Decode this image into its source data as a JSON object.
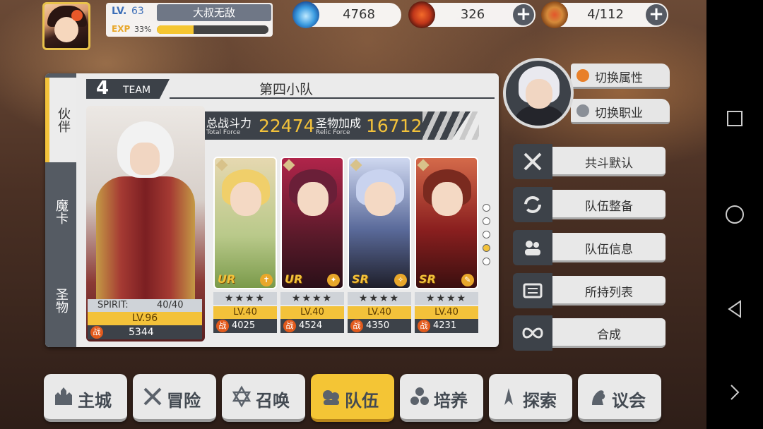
{
  "player": {
    "lv_label": "LV.",
    "level": "63",
    "name": "大叔无敌",
    "exp_label": "EXP",
    "exp_percent_text": "33%",
    "exp_fraction": 0.33
  },
  "resources": [
    {
      "icon": "blue-flame-icon",
      "value": "4768"
    },
    {
      "icon": "stamina-banner-icon",
      "value": "326",
      "plus": "+"
    },
    {
      "icon": "hotdog-food-icon",
      "value": "4/112",
      "plus": "+"
    }
  ],
  "side_tabs": [
    "伙伴",
    "魔卡",
    "圣物"
  ],
  "team": {
    "number": "4",
    "word": "TEAM",
    "name": "第四小队",
    "total_force_label": "总战斗力",
    "total_force_sub": "Total Force",
    "total_force_value": "22474",
    "relic_force_label": "圣物加成",
    "relic_force_sub": "Relic Force",
    "relic_force_value": "16712"
  },
  "leader": {
    "spirit_label": "SPIRIT:",
    "spirit_value": "40/40",
    "level": "LV.96",
    "power_icon": "战",
    "power": "5344"
  },
  "members": [
    {
      "rank": "UR",
      "stars": "★★★★",
      "level": "LV.40",
      "power_icon": "战",
      "power": "4025",
      "badge": "✝"
    },
    {
      "rank": "UR",
      "stars": "★★★★",
      "level": "LV.40",
      "power_icon": "战",
      "power": "4524",
      "badge": "✦"
    },
    {
      "rank": "SR",
      "stars": "★★★★",
      "level": "LV.40",
      "power_icon": "战",
      "power": "4350",
      "badge": "✧"
    },
    {
      "rank": "SR",
      "stars": "★★★★",
      "level": "LV.40",
      "power_icon": "战",
      "power": "4231",
      "badge": "✎"
    }
  ],
  "page_dots": {
    "count": 5,
    "active_index": 3
  },
  "switch_buttons": [
    {
      "label": "切换属性",
      "icon": "flame-icon"
    },
    {
      "label": "切换职业",
      "icon": "tools-icon"
    }
  ],
  "side_buttons": [
    {
      "label": "共斗默认",
      "icon": "crossed-swords-icon"
    },
    {
      "label": "队伍整备",
      "icon": "refresh-icon"
    },
    {
      "label": "队伍信息",
      "icon": "team-info-icon"
    },
    {
      "label": "所持列表",
      "icon": "list-icon"
    },
    {
      "label": "合成",
      "icon": "infinity-icon"
    }
  ],
  "bottom_menu": [
    {
      "label": "主城",
      "icon": "castle-icon"
    },
    {
      "label": "冒险",
      "icon": "swords-icon"
    },
    {
      "label": "召唤",
      "icon": "hexagram-icon"
    },
    {
      "label": "队伍",
      "icon": "team-helmet-icon",
      "active": true
    },
    {
      "label": "培养",
      "icon": "orbs-icon"
    },
    {
      "label": "探索",
      "icon": "compass-icon"
    },
    {
      "label": "议会",
      "icon": "lion-crest-icon"
    }
  ],
  "colors": {
    "accent": "#f3c23a",
    "dark_panel": "#3d4249",
    "power_orange": "#e25a1c"
  }
}
